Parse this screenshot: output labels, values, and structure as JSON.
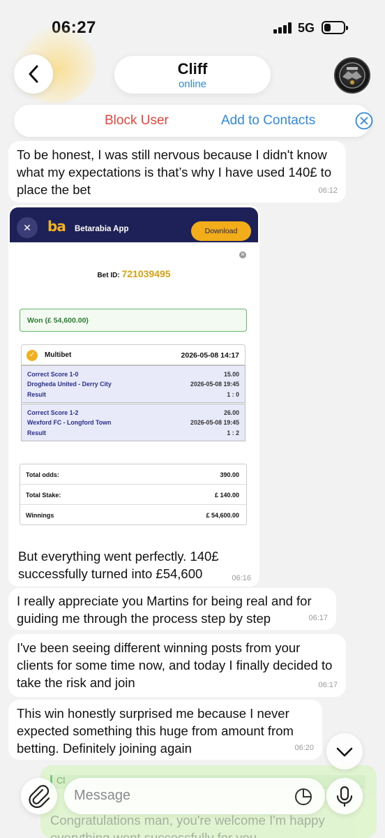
{
  "status_bar": {
    "time": "06:27",
    "network": "5G",
    "battery_level": 0.35
  },
  "header": {
    "name": "Cliff",
    "status": "online"
  },
  "action_bar": {
    "block_label": "Block User",
    "add_contacts_label": "Add to Contacts"
  },
  "messages": [
    {
      "text": "To be honest, I was still nervous because I didn't know what my expectations is that’s why I have used 140£ to place the bet",
      "time": "06:12"
    },
    {
      "text": "But everything went perfectly. 140£ successfully turned into £54,600",
      "time": "06:16"
    },
    {
      "text": "I really appreciate you Martins for being real and for guiding me through the process step by step",
      "time": "06:17"
    },
    {
      "text": "I've been seeing different winning posts from your clients for some time now, and today I finally decided to take the risk and join",
      "time": "06:17"
    },
    {
      "text": "This win honestly surprised me because I never expected something this huge from amount from betting. Definitely joining again",
      "time": "06:20"
    }
  ],
  "ticket": {
    "logo": "ba",
    "app_name": "Betarabia App",
    "download_label": "Download",
    "bet_id_label": "Bet ID:",
    "bet_id": "721039495",
    "won": "Won (£ 54,600.00)",
    "multibet_label": "Multibet",
    "multibet_date": "2026-05-08 14:17",
    "selections": [
      {
        "market": "Correct Score 1-0",
        "odds": "15.00",
        "match": "Drogheda United - Derry City",
        "date": "2026-05-08 19:45",
        "result_label": "Result",
        "result": "1 : 0"
      },
      {
        "market": "Correct Score 1-2",
        "odds": "26.00",
        "match": "Wexford FC - Longford Town",
        "date": "2026-05-08 19:45",
        "result_label": "Result",
        "result": "1 : 2"
      }
    ],
    "totals": [
      {
        "label": "Total odds:",
        "value": "390.00"
      },
      {
        "label": "Total Stake:",
        "value": "£ 140.00"
      },
      {
        "label": "Winnings",
        "value": "£ 54,600.00"
      }
    ]
  },
  "reply_preview": {
    "author": "Cl",
    "text": "Congratulations man, you're welcome I'm happy everything went successfully for you"
  },
  "composer": {
    "placeholder": "Message"
  },
  "colors": {
    "accent": "#2f8ae0",
    "danger": "#e8463c",
    "ticket_header": "#1e2157",
    "gold": "#f4ad1a"
  }
}
